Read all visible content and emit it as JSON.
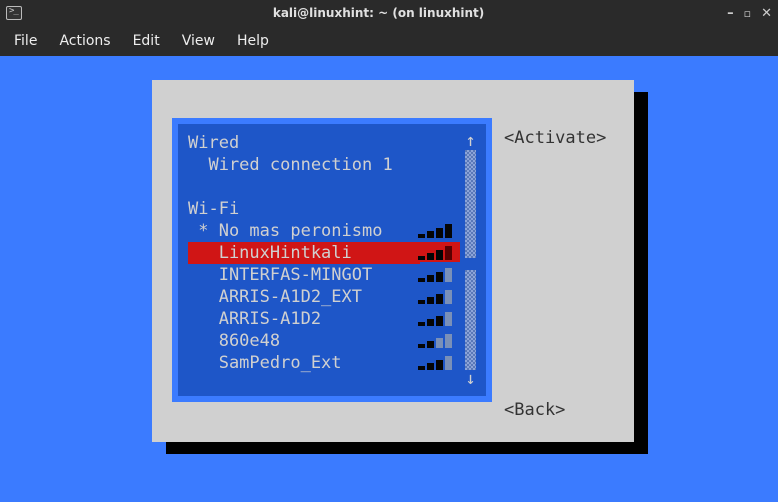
{
  "window": {
    "title": "kali@linuxhint: ~ (on linuxhint)"
  },
  "menubar": [
    "File",
    "Actions",
    "Edit",
    "View",
    "Help"
  ],
  "dialog": {
    "buttons": {
      "activate": "<Activate>",
      "back": "<Back>"
    },
    "sections": {
      "wired_header": "Wired",
      "wired_items": [
        {
          "label": "Wired connection 1"
        }
      ],
      "wifi_header": "Wi-Fi",
      "wifi_items": [
        {
          "marker": "*",
          "label": "No mas peronismo",
          "signal": 4,
          "selected": false
        },
        {
          "marker": " ",
          "label": "LinuxHintkali",
          "signal": 3,
          "selected": true
        },
        {
          "marker": " ",
          "label": "INTERFAS-MINGOT",
          "signal": 3,
          "selected": false
        },
        {
          "marker": " ",
          "label": "ARRIS-A1D2_EXT",
          "signal": 3,
          "selected": false
        },
        {
          "marker": " ",
          "label": "ARRIS-A1D2",
          "signal": 3,
          "selected": false
        },
        {
          "marker": " ",
          "label": "860e48",
          "signal": 2,
          "selected": false
        },
        {
          "marker": " ",
          "label": "SamPedro_Ext",
          "signal": 3,
          "selected": false
        }
      ]
    },
    "scroll": {
      "up": "↑",
      "down": "↓"
    }
  }
}
